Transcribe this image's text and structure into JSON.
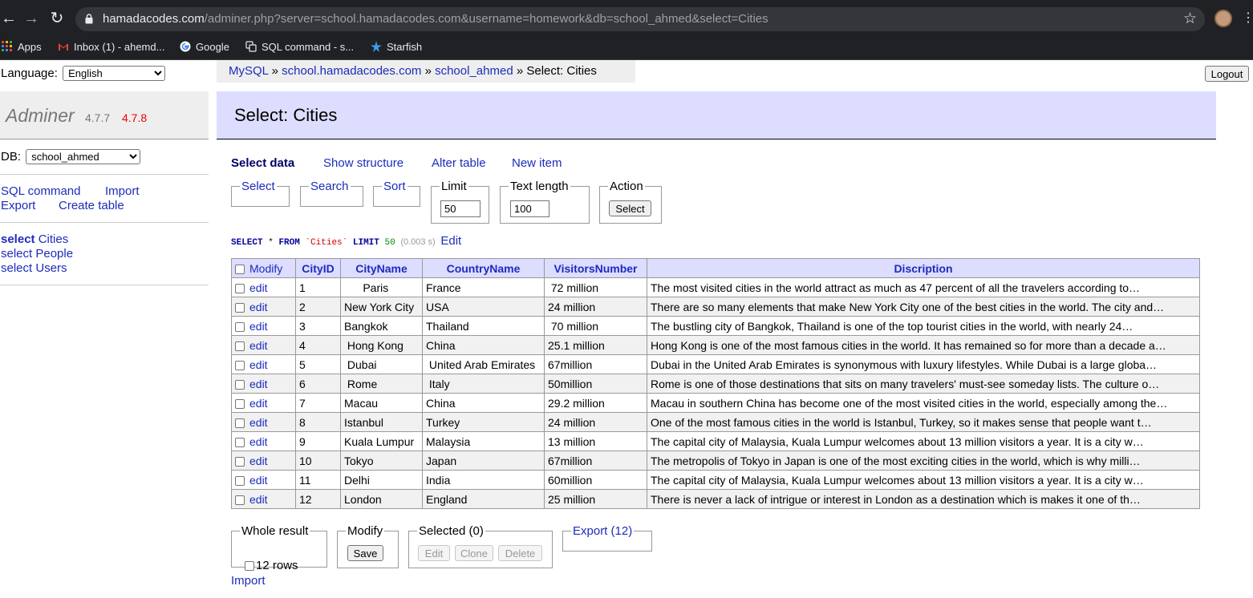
{
  "browser": {
    "url_host": "hamadacodes.com",
    "url_path": "/adminer.php?server=school.hamadacodes.com&username=homework&db=school_ahmed&select=Cities",
    "bookmarks": [
      "Apps",
      "Inbox (1) - ahemd...",
      "Google",
      "SQL command - s...",
      "Starfish"
    ]
  },
  "sidebar": {
    "language_label": "Language:",
    "language_value": "English",
    "app_name": "Adminer",
    "version": "4.7.7",
    "new_version": "4.7.8",
    "db_label": "DB:",
    "db_value": "school_ahmed",
    "links": {
      "sql_command": "SQL command",
      "import": "Import",
      "export": "Export",
      "create_table": "Create table"
    },
    "tables": [
      {
        "prefix": "select",
        "name": "Cities"
      },
      {
        "prefix": "select",
        "name": "People"
      },
      {
        "prefix": "select",
        "name": "Users"
      }
    ]
  },
  "breadcrumb": {
    "mysql": "MySQL",
    "sep": "»",
    "server": "school.hamadacodes.com",
    "db": "school_ahmed",
    "current": "Select: Cities"
  },
  "logout": "Logout",
  "title": "Select: Cities",
  "tabs": {
    "select_data": "Select data",
    "show_structure": "Show structure",
    "alter_table": "Alter table",
    "new_item": "New item"
  },
  "form": {
    "select": "Select",
    "search": "Search",
    "sort": "Sort",
    "limit_label": "Limit",
    "limit_value": "50",
    "text_length_label": "Text length",
    "text_length_value": "100",
    "action_label": "Action",
    "action_button": "Select"
  },
  "sql": {
    "select": "SELECT",
    "star": "*",
    "from": "FROM",
    "table": "`Cities`",
    "limit": "LIMIT",
    "limit_num": "50",
    "time": "(0.003 s)",
    "edit": "Edit"
  },
  "columns": [
    "Modify",
    "CityID",
    "CityName",
    "CountryName",
    "VisitorsNumber",
    "Discription"
  ],
  "edit_label": "edit",
  "rows": [
    [
      "1",
      "      Paris",
      "France",
      " 72 million",
      "The most visited cities in the world attract as much as 47 percent of all the travelers according to…"
    ],
    [
      "2",
      "New York City",
      "USA",
      "24 million",
      "There are so many elements that make New York City one of the best cities in the world. The city and…"
    ],
    [
      "3",
      "Bangkok",
      "Thailand",
      " 70 million",
      "The bustling city of Bangkok, Thailand is one of the top tourist cities in the world, with nearly 24…"
    ],
    [
      "4",
      " Hong Kong",
      "China",
      "25.1 million",
      "Hong Kong is one of the most famous cities in the world. It has remained so for more than a decade a…"
    ],
    [
      "5",
      " Dubai",
      " United Arab Emirates",
      "67million",
      "Dubai in the United Arab Emirates is synonymous with luxury lifestyles. While Dubai is a large globa…"
    ],
    [
      "6",
      " Rome",
      " Italy",
      "50million",
      "Rome is one of those destinations that sits on many travelers' must-see someday lists. The culture o…"
    ],
    [
      "7",
      "Macau",
      "China",
      "29.2 million",
      "Macau in southern China has become one of the most visited cities in the world, especially among the…"
    ],
    [
      "8",
      "Istanbul",
      "Turkey",
      "24 million",
      "One of the most famous cities in the world is Istanbul, Turkey, so it makes sense that people want t…"
    ],
    [
      "9",
      "Kuala Lumpur",
      "Malaysia",
      "13 million",
      "The capital city of Malaysia, Kuala Lumpur welcomes about 13 million visitors a year. It is a city w…"
    ],
    [
      "10",
      "Tokyo",
      "Japan",
      "67million",
      "The metropolis of Tokyo in Japan is one of the most exciting cities in the world, which is why milli…"
    ],
    [
      "11",
      "Delhi",
      "India",
      "60million",
      "The capital city of Malaysia, Kuala Lumpur welcomes about 13 million visitors a year. It is a city w…"
    ],
    [
      "12",
      "London",
      "England",
      "25 million",
      "There is never a lack of intrigue or interest in London as a destination which is makes it one of th…"
    ]
  ],
  "footer": {
    "whole_result": "Whole result",
    "rows_label": "12 rows",
    "modify": "Modify",
    "save": "Save",
    "selected": "Selected (0)",
    "edit": "Edit",
    "clone": "Clone",
    "delete": "Delete",
    "export": "Export (12)",
    "import": "Import"
  }
}
